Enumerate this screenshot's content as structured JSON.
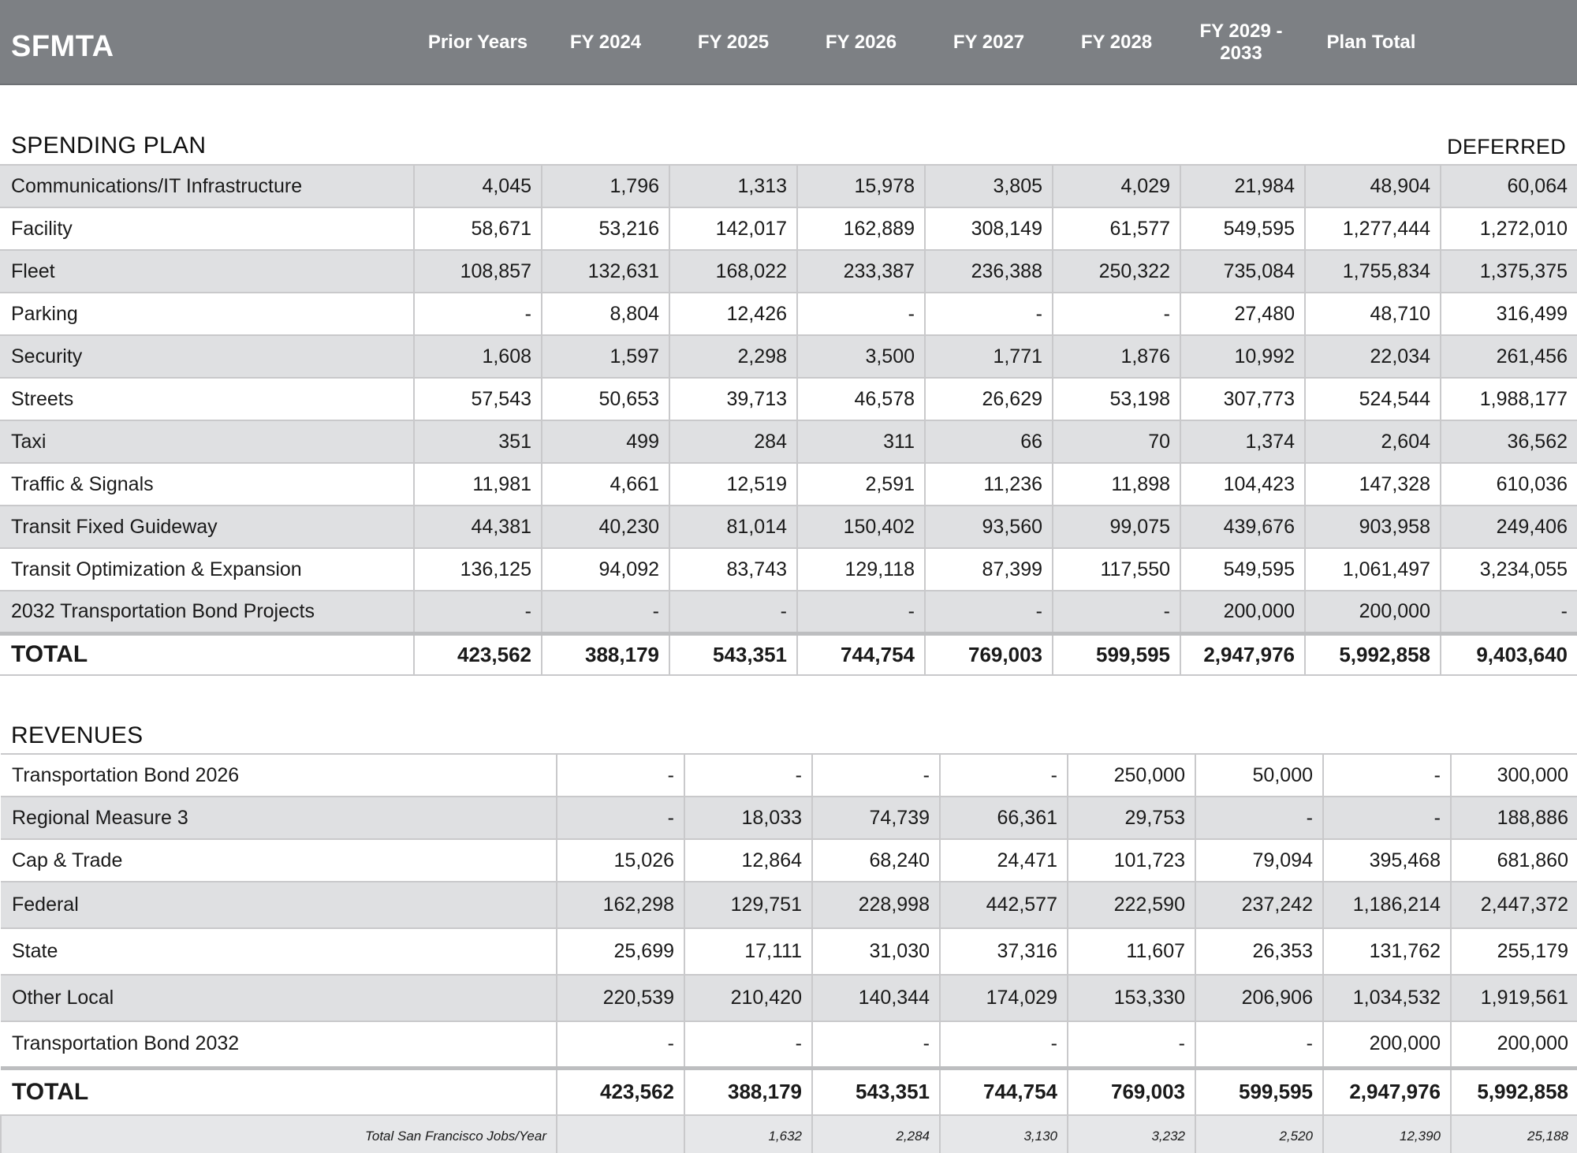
{
  "header": {
    "brand": "SFMTA",
    "columns": [
      "Prior Years",
      "FY 2024",
      "FY 2025",
      "FY 2026",
      "FY 2027",
      "FY 2028",
      "FY 2029 - 2033",
      "Plan Total"
    ]
  },
  "spending": {
    "title": "SPENDING PLAN",
    "deferred_label": "DEFERRED",
    "rows": [
      {
        "label": "Communications/IT Infrastructure",
        "values": [
          "4,045",
          "1,796",
          "1,313",
          "15,978",
          "3,805",
          "4,029",
          "21,984",
          "48,904",
          "60,064"
        ]
      },
      {
        "label": "Facility",
        "values": [
          "58,671",
          "53,216",
          "142,017",
          "162,889",
          "308,149",
          "61,577",
          "549,595",
          "1,277,444",
          "1,272,010"
        ]
      },
      {
        "label": "Fleet",
        "values": [
          "108,857",
          "132,631",
          "168,022",
          "233,387",
          "236,388",
          "250,322",
          "735,084",
          "1,755,834",
          "1,375,375"
        ]
      },
      {
        "label": "Parking",
        "values": [
          "-",
          "8,804",
          "12,426",
          "-",
          "-",
          "-",
          "27,480",
          "48,710",
          "316,499"
        ]
      },
      {
        "label": "Security",
        "values": [
          "1,608",
          "1,597",
          "2,298",
          "3,500",
          "1,771",
          "1,876",
          "10,992",
          "22,034",
          "261,456"
        ]
      },
      {
        "label": "Streets",
        "values": [
          "57,543",
          "50,653",
          "39,713",
          "46,578",
          "26,629",
          "53,198",
          "307,773",
          "524,544",
          "1,988,177"
        ]
      },
      {
        "label": "Taxi",
        "values": [
          "351",
          "499",
          "284",
          "311",
          "66",
          "70",
          "1,374",
          "2,604",
          "36,562"
        ]
      },
      {
        "label": "Traffic & Signals",
        "values": [
          "11,981",
          "4,661",
          "12,519",
          "2,591",
          "11,236",
          "11,898",
          "104,423",
          "147,328",
          "610,036"
        ]
      },
      {
        "label": "Transit Fixed Guideway",
        "values": [
          "44,381",
          "40,230",
          "81,014",
          "150,402",
          "93,560",
          "99,075",
          "439,676",
          "903,958",
          "249,406"
        ]
      },
      {
        "label": "Transit Optimization & Expansion",
        "values": [
          "136,125",
          "94,092",
          "83,743",
          "129,118",
          "87,399",
          "117,550",
          "549,595",
          "1,061,497",
          "3,234,055"
        ]
      },
      {
        "label": "2032 Transportation Bond Projects",
        "values": [
          "-",
          "-",
          "-",
          "-",
          "-",
          "-",
          "200,000",
          "200,000",
          "-"
        ]
      }
    ],
    "total": {
      "label": "TOTAL",
      "values": [
        "423,562",
        "388,179",
        "543,351",
        "744,754",
        "769,003",
        "599,595",
        "2,947,976",
        "5,992,858",
        "9,403,640"
      ]
    }
  },
  "revenues": {
    "title": "REVENUES",
    "rows": [
      {
        "label": "Transportation Bond 2026",
        "values": [
          "-",
          "-",
          "-",
          "-",
          "250,000",
          "50,000",
          "-",
          "300,000"
        ]
      },
      {
        "label": "Regional Measure 3",
        "values": [
          "-",
          "18,033",
          "74,739",
          "66,361",
          "29,753",
          "-",
          "-",
          "188,886"
        ]
      },
      {
        "label": "Cap & Trade",
        "values": [
          "15,026",
          "12,864",
          "68,240",
          "24,471",
          "101,723",
          "79,094",
          "395,468",
          "681,860"
        ]
      },
      {
        "label": "Federal",
        "values": [
          "162,298",
          "129,751",
          "228,998",
          "442,577",
          "222,590",
          "237,242",
          "1,186,214",
          "2,447,372"
        ]
      },
      {
        "label": "State",
        "values": [
          "25,699",
          "17,111",
          "31,030",
          "37,316",
          "11,607",
          "26,353",
          "131,762",
          "255,179"
        ]
      },
      {
        "label": "Other Local",
        "values": [
          "220,539",
          "210,420",
          "140,344",
          "174,029",
          "153,330",
          "206,906",
          "1,034,532",
          "1,919,561"
        ]
      },
      {
        "label": "Transportation Bond 2032",
        "values": [
          "-",
          "-",
          "-",
          "-",
          "-",
          "-",
          "200,000",
          "200,000"
        ]
      }
    ],
    "total": {
      "label": "TOTAL",
      "values": [
        "423,562",
        "388,179",
        "543,351",
        "744,754",
        "769,003",
        "599,595",
        "2,947,976",
        "5,992,858"
      ]
    },
    "jobs": {
      "label": "Total San Francisco Jobs/Year",
      "values": [
        "",
        "1,632",
        "2,284",
        "3,130",
        "3,232",
        "2,520",
        "12,390",
        "25,188"
      ]
    }
  }
}
